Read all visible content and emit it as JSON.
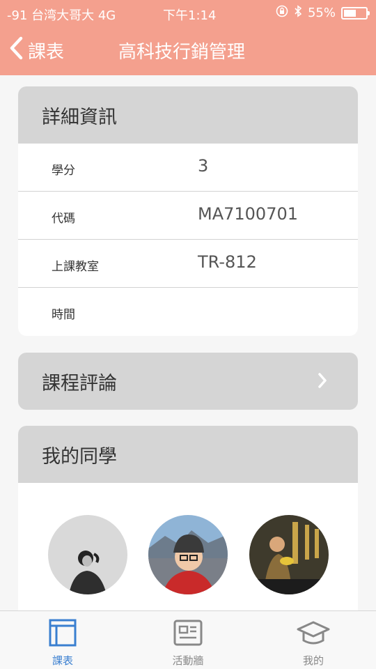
{
  "status": {
    "carrier": "-91 台湾大哥大  4G",
    "time": "下午1:14",
    "battery": "55%",
    "battery_level": 0.55
  },
  "nav": {
    "back_label": "課表",
    "title": "高科技行銷管理"
  },
  "details": {
    "heading": "詳細資訊",
    "rows": [
      {
        "label": "學分",
        "value": "3"
      },
      {
        "label": "代碼",
        "value": "MA7100701"
      },
      {
        "label": "上課教室",
        "value": "TR-812"
      },
      {
        "label": "時間",
        "value": ""
      }
    ]
  },
  "reviews": {
    "heading": "課程評論"
  },
  "classmates": {
    "heading": "我的同學"
  },
  "tabs": [
    {
      "label": "課表",
      "icon": "schedule-icon"
    },
    {
      "label": "活動牆",
      "icon": "newspaper-icon"
    },
    {
      "label": "我的",
      "icon": "graduation-cap-icon"
    }
  ],
  "colors": {
    "header": "#f4a08e",
    "card_head": "#d5d5d5",
    "active_tab": "#3a7fd0",
    "inactive_tab": "#888888"
  }
}
